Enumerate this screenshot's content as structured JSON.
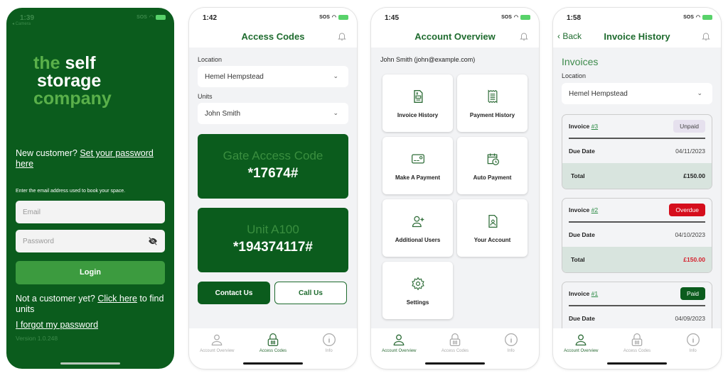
{
  "colors": {
    "brand_green": "#0b5c1d",
    "accent_green": "#3c9b3f",
    "overdue_red": "#d50e1c",
    "tab_active": "#2d6c37"
  },
  "login_screen": {
    "status_time": "1:39",
    "back_app": "◂ Camera",
    "logo": {
      "word1": "the",
      "word2": "self",
      "word3": "storage",
      "word4": "company"
    },
    "new_customer_text": "New customer?",
    "set_password_link": "Set your password here",
    "hint": "Enter the email address used to book your space.",
    "email_placeholder": "Email",
    "password_placeholder": "Password",
    "password_toggle_icon": "eye-slash-icon",
    "login_label": "Login",
    "not_customer_text": "Not a customer yet?",
    "click_here_link": "Click here",
    "find_units_text": "to find units",
    "forgot_link": "I forgot my password",
    "version": "Version 1.0.248"
  },
  "access_codes_screen": {
    "status_time": "1:42",
    "title": "Access Codes",
    "location_label": "Location",
    "location_value": "Hemel Hempstead",
    "units_label": "Units",
    "units_value": "John Smith",
    "gate_label": "Gate Access Code",
    "gate_code": "*17674#",
    "unit_label": "Unit A100",
    "unit_code": "*194374117#",
    "contact_label": "Contact Us",
    "call_label": "Call Us"
  },
  "account_overview_screen": {
    "status_time": "1:45",
    "title": "Account Overview",
    "user_line": "John Smith (john@example.com)",
    "tiles": [
      {
        "label": "Invoice History",
        "icon": "invoice-icon"
      },
      {
        "label": "Payment History",
        "icon": "receipt-icon"
      },
      {
        "label": "Make A Payment",
        "icon": "card-icon"
      },
      {
        "label": "Auto Payment",
        "icon": "calendar-clock-icon"
      },
      {
        "label": "Additional Users",
        "icon": "user-plus-icon"
      },
      {
        "label": "Your Account",
        "icon": "account-doc-icon"
      },
      {
        "label": "Settings",
        "icon": "gear-icon"
      }
    ]
  },
  "invoice_history_screen": {
    "status_time": "1:58",
    "back_label": "Back",
    "title": "Invoice History",
    "heading": "Invoices",
    "location_label": "Location",
    "location_value": "Hemel Hempstead",
    "invoice_word": "Invoice",
    "due_date_label": "Due Date",
    "total_label": "Total",
    "invoices": [
      {
        "number": "#3",
        "status": "Unpaid",
        "due_date": "04/11/2023",
        "total": "£150.00"
      },
      {
        "number": "#2",
        "status": "Overdue",
        "due_date": "04/10/2023",
        "total": "£150.00"
      },
      {
        "number": "#1",
        "status": "Paid",
        "due_date": "04/09/2023"
      }
    ]
  },
  "status_bar": {
    "carrier": "SOS"
  },
  "tabbar": {
    "items": [
      "Account Overview",
      "Access Codes",
      "Info"
    ]
  }
}
